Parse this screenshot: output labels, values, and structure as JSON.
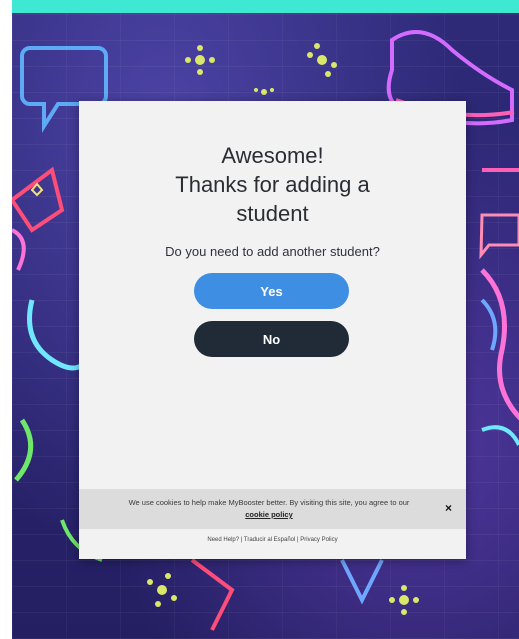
{
  "modal": {
    "title_line1": "Awesome!",
    "title_line2": "Thanks for adding a",
    "title_line3": "student",
    "question": "Do you need to add another student?",
    "yes_label": "Yes",
    "no_label": "No"
  },
  "cookie": {
    "text": "We use cookies to help make MyBooster better. By visiting this site, you agree to our",
    "link": "cookie policy",
    "close": "×"
  },
  "footer": {
    "help": "Need Help?",
    "translate": "Traducir al Español",
    "privacy": "Privacy Policy",
    "separator": " | "
  },
  "colors": {
    "accent_bar": "#3ee8d2",
    "yes_button": "#3e8fe3",
    "no_button": "#212b38",
    "background": "#2a2570"
  }
}
